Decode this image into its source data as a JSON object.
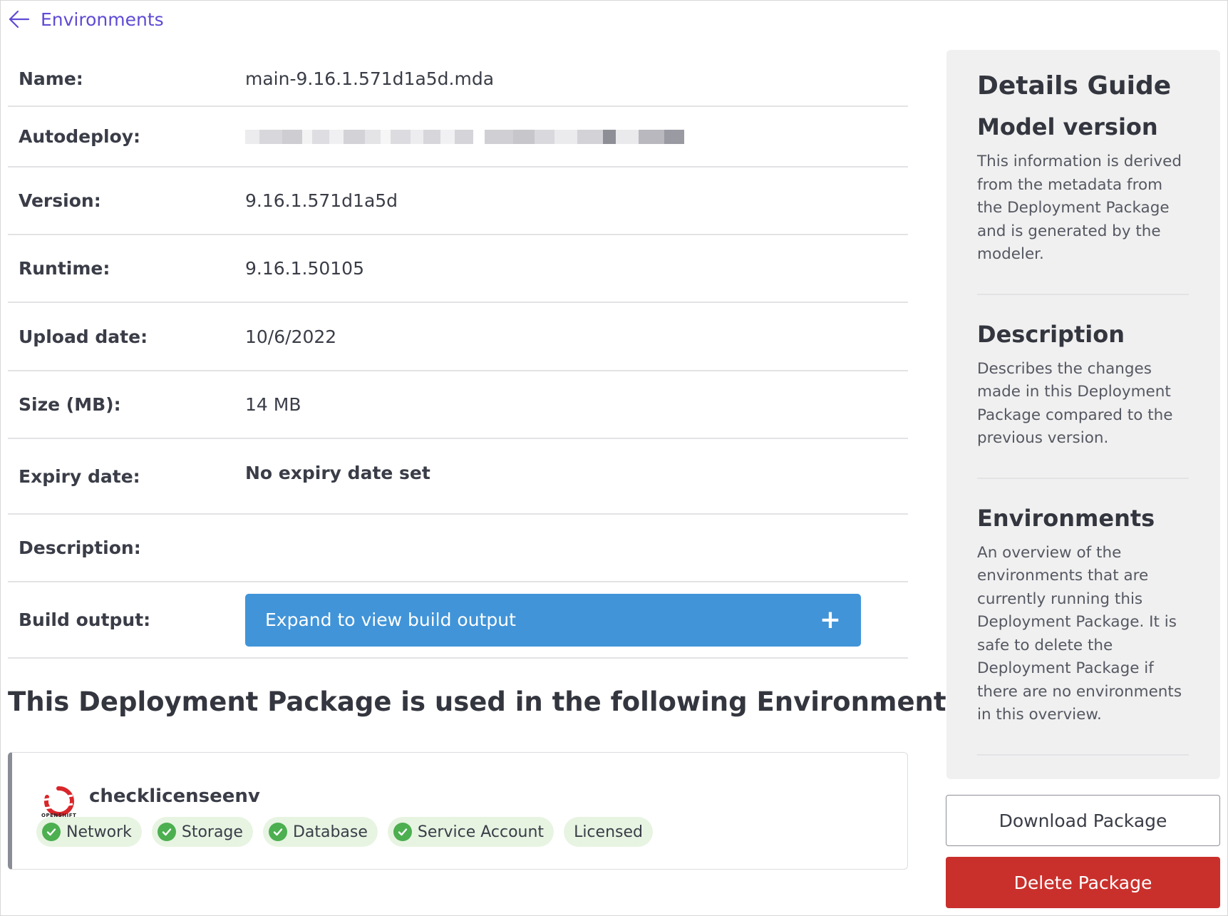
{
  "nav": {
    "back_label": "Environments"
  },
  "details": {
    "name": {
      "label": "Name:",
      "value": "main-9.16.1.571d1a5d.mda"
    },
    "autodeploy": {
      "label": "Autodeploy:",
      "value": ""
    },
    "version": {
      "label": "Version:",
      "value": "9.16.1.571d1a5d"
    },
    "runtime": {
      "label": "Runtime:",
      "value": "9.16.1.50105"
    },
    "upload_date": {
      "label": "Upload date:",
      "value": "10/6/2022"
    },
    "size": {
      "label": "Size (MB):",
      "value": "14 MB"
    },
    "expiry_date": {
      "label": "Expiry date:",
      "value": "No expiry date set"
    },
    "description": {
      "label": "Description:",
      "value": ""
    },
    "build_output": {
      "label": "Build output:",
      "button_label": "Expand to view build output",
      "button_icon": "plus-icon"
    }
  },
  "environments_section": {
    "title": "This Deployment Package is used in the following Environments",
    "environments": [
      {
        "name": "checklicenseenv",
        "platform_logo_text": "OPENSHIFT",
        "tags": [
          {
            "label": "Network",
            "checked": true
          },
          {
            "label": "Storage",
            "checked": true
          },
          {
            "label": "Database",
            "checked": true
          },
          {
            "label": "Service Account",
            "checked": true
          },
          {
            "label": "Licensed",
            "checked": false
          }
        ]
      }
    ]
  },
  "guide": {
    "title": "Details Guide",
    "sections": [
      {
        "heading": "Model version",
        "text": "This information is derived from the metadata from the Deployment Package and is generated by the modeler."
      },
      {
        "heading": "Description",
        "text": "Describes the changes made in this Deployment Package compared to the previous version."
      },
      {
        "heading": "Environments",
        "text": "An overview of the environments that are currently running this Deployment Package. It is safe to delete the Deployment Package if there are no environments in this overview."
      }
    ]
  },
  "actions": {
    "download_label": "Download Package",
    "delete_label": "Delete Package"
  },
  "colors": {
    "accent_link": "#5e4bd4",
    "expand_button": "#4194d8",
    "delete_button": "#c9302c",
    "tag_background": "#e7f4e2",
    "check_green": "#4caf50",
    "openshift_red": "#d9262b"
  }
}
